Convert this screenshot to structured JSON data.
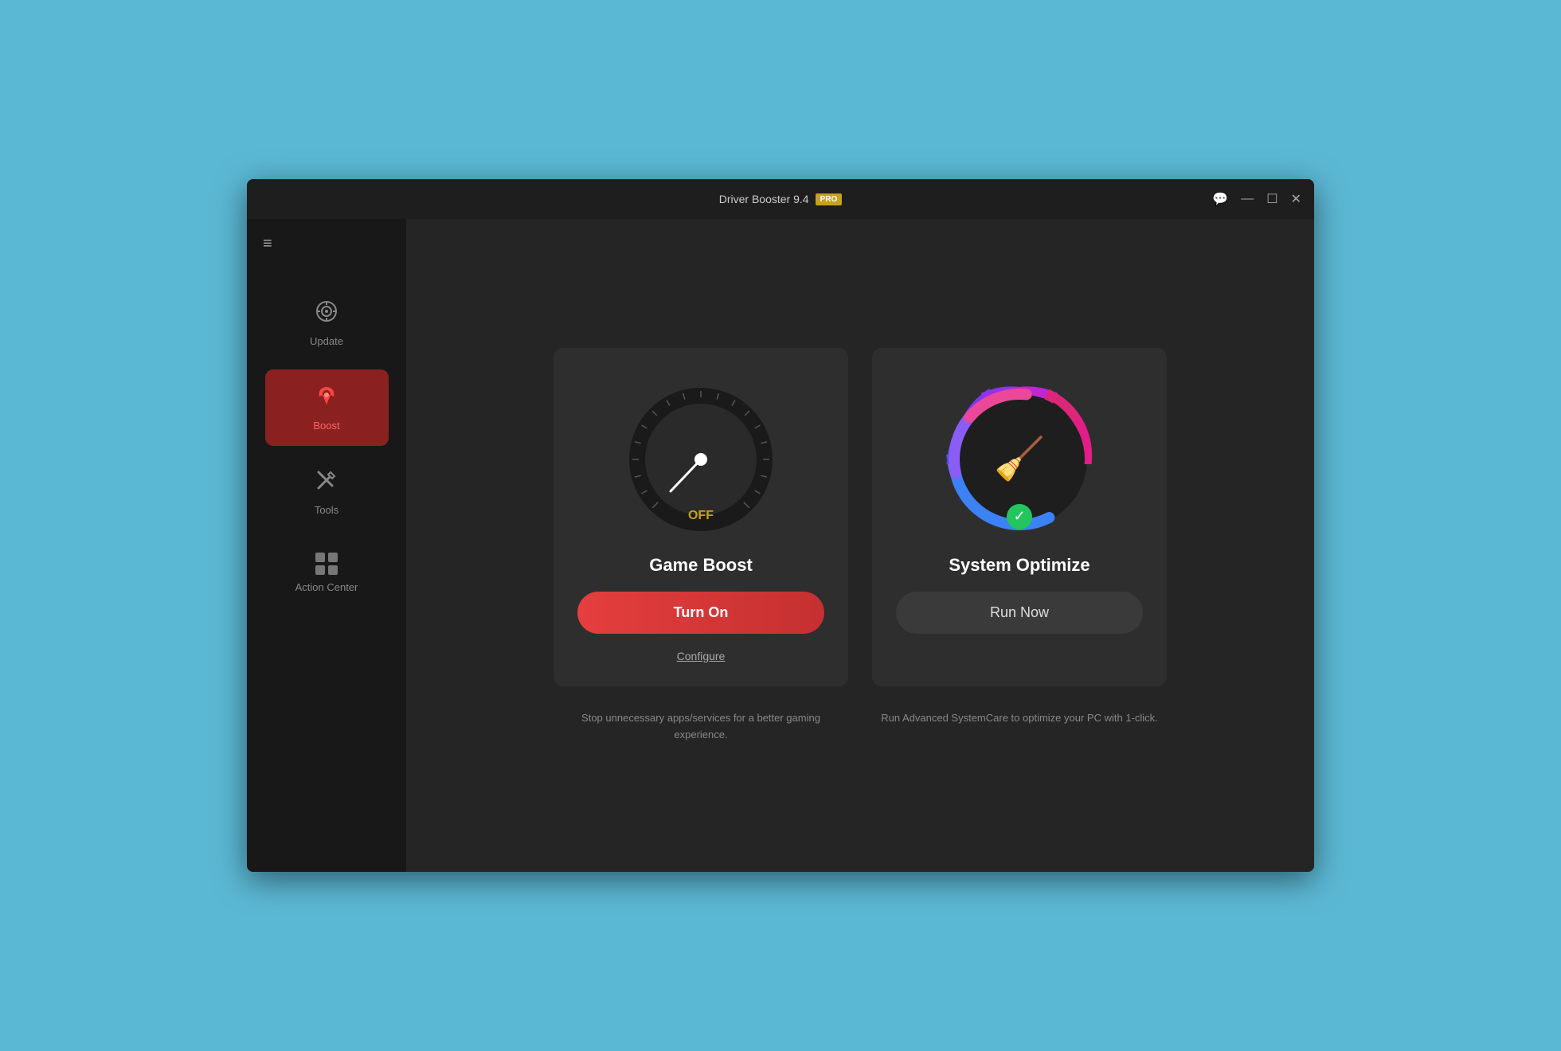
{
  "window": {
    "title": "Driver Booster 9.4",
    "pro_badge": "PRO"
  },
  "titlebar": {
    "chat_icon": "💬",
    "minimize_icon": "—",
    "maximize_icon": "☐",
    "close_icon": "✕"
  },
  "sidebar": {
    "hamburger": "≡",
    "items": [
      {
        "id": "update",
        "label": "Update",
        "icon": "⚙",
        "active": false
      },
      {
        "id": "boost",
        "label": "Boost",
        "icon": "🚀",
        "active": true
      },
      {
        "id": "tools",
        "label": "Tools",
        "icon": "🔧",
        "active": false
      },
      {
        "id": "action-center",
        "label": "Action Center",
        "icon": "grid",
        "active": false
      }
    ]
  },
  "game_boost": {
    "status": "OFF",
    "title": "Game Boost",
    "turn_on_label": "Turn On",
    "configure_label": "Configure",
    "description": "Stop unnecessary apps/services for a better gaming experience."
  },
  "system_optimize": {
    "title": "System Optimize",
    "run_now_label": "Run Now",
    "description": "Run Advanced SystemCare to optimize your PC with 1-click."
  },
  "colors": {
    "accent_red": "#e53e3e",
    "accent_gold": "#c8a020",
    "active_bg": "#8b2020",
    "sidebar_bg": "#181818",
    "card_bg": "#2e2e2e",
    "content_bg": "#252525"
  }
}
